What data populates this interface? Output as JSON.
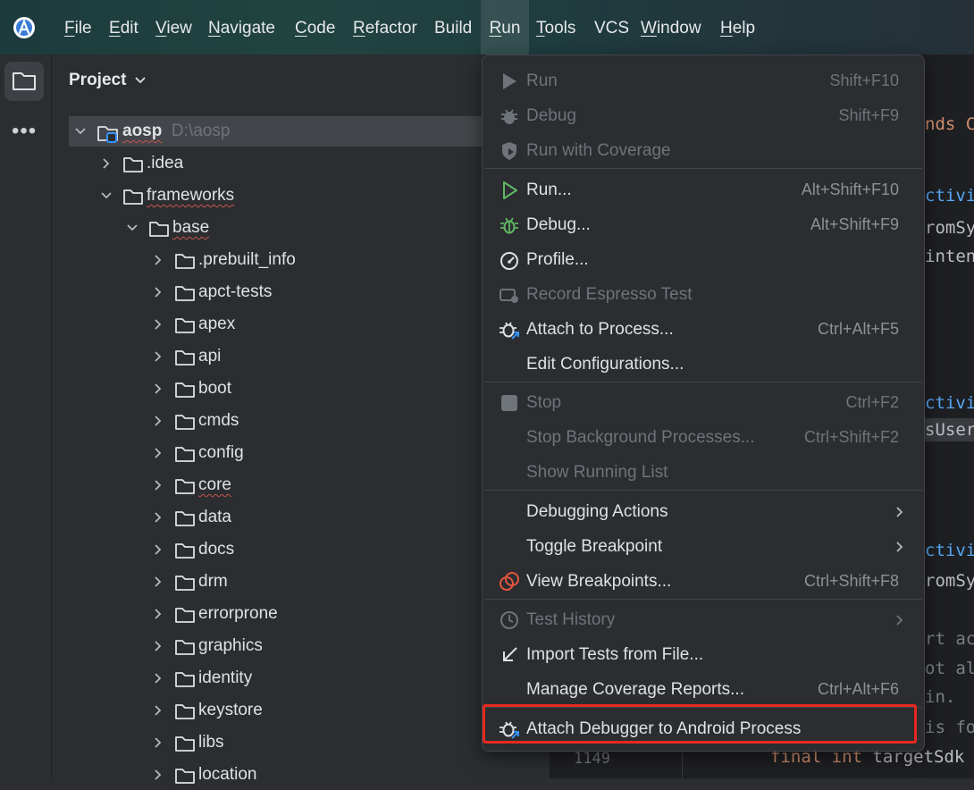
{
  "menubar": {
    "items": [
      {
        "first": "F",
        "rest": "ile"
      },
      {
        "first": "E",
        "rest": "dit"
      },
      {
        "first": "V",
        "rest": "iew"
      },
      {
        "first": "N",
        "rest": "avigate"
      },
      {
        "first": "C",
        "rest": "ode"
      },
      {
        "first": "R",
        "rest": "efactor"
      },
      {
        "first": "",
        "rest": "Build"
      },
      {
        "first": "R",
        "rest": "un"
      },
      {
        "first": "T",
        "rest": "ools"
      },
      {
        "first": "",
        "rest": "VCS"
      },
      {
        "first": "W",
        "rest": "indow"
      },
      {
        "first": "H",
        "rest": "elp"
      }
    ]
  },
  "project": {
    "header": "Project",
    "root_name": "aosp",
    "root_path": "D:\\aosp",
    "nodes": [
      ".idea",
      "frameworks",
      "base",
      ".prebuilt_info",
      "apct-tests",
      "apex",
      "api",
      "boot",
      "cmds",
      "config",
      "core",
      "data",
      "docs",
      "drm",
      "errorprone",
      "graphics",
      "identity",
      "keystore",
      "libs",
      "location"
    ]
  },
  "editor": {
    "lines": [
      {
        "kind": "kw",
        "text": "nds C"
      },
      {
        "kind": "fn",
        "text": "ctivi"
      },
      {
        "kind": "plain",
        "text": "romSy"
      },
      {
        "kind": "plain",
        "text": "inten"
      },
      {
        "kind": "fn",
        "text": "ctivi"
      },
      {
        "kind": "plain",
        "text": "sUser"
      },
      {
        "kind": "fn",
        "text": "ctivi"
      },
      {
        "kind": "plain",
        "text": "romSy"
      },
      {
        "kind": "comment",
        "text": "rt ac"
      },
      {
        "kind": "comment",
        "text": "ot al"
      },
      {
        "kind": "comment",
        "text": " in."
      },
      {
        "kind": "comment",
        "text": "is fo"
      }
    ],
    "gutter_number": "1149",
    "last_line_kw": "final int",
    "last_line_rest": " targetSdk"
  },
  "run_menu": {
    "items": [
      {
        "label": "Run",
        "shortcut": "Shift+F10",
        "icon": "run-triangle-icon"
      },
      {
        "label": "Debug",
        "shortcut": "Shift+F9",
        "icon": "debug-bug-icon"
      },
      {
        "label": "Run with Coverage",
        "shortcut": "",
        "icon": "coverage-shield-icon"
      },
      {
        "label": "Run...",
        "shortcut": "Alt+Shift+F10",
        "icon": "run-outline-icon"
      },
      {
        "label": "Debug...",
        "shortcut": "Alt+Shift+F9",
        "icon": "debug-outline-icon"
      },
      {
        "label": "Profile...",
        "shortcut": "",
        "icon": "profile-gauge-icon"
      },
      {
        "label": "Record Espresso Test",
        "shortcut": "",
        "icon": "record-espresso-icon"
      },
      {
        "label": "Attach to Process...",
        "shortcut": "Ctrl+Alt+F5",
        "icon": "attach-process-icon"
      },
      {
        "label": "Edit Configurations...",
        "shortcut": "",
        "icon": ""
      },
      {
        "label": "Stop",
        "shortcut": "Ctrl+F2",
        "icon": "stop-square-icon"
      },
      {
        "label": "Stop Background Processes...",
        "shortcut": "Ctrl+Shift+F2",
        "icon": ""
      },
      {
        "label": "Show Running List",
        "shortcut": "",
        "icon": ""
      },
      {
        "label": "Debugging Actions",
        "shortcut": "",
        "icon": ""
      },
      {
        "label": "Toggle Breakpoint",
        "shortcut": "",
        "icon": ""
      },
      {
        "label": "View Breakpoints...",
        "shortcut": "Ctrl+Shift+F8",
        "icon": "breakpoints-icon"
      },
      {
        "label": "Test History",
        "shortcut": "",
        "icon": "clock-icon"
      },
      {
        "label": "Import Tests from File...",
        "shortcut": "",
        "icon": "import-arrow-icon"
      },
      {
        "label": "Manage Coverage Reports...",
        "shortcut": "Ctrl+Alt+F6",
        "icon": ""
      },
      {
        "label": "Attach Debugger to Android Process",
        "shortcut": "",
        "icon": "attach-debugger-android-icon"
      }
    ]
  },
  "colors": {
    "accent_green": "#5fb865",
    "highlight_red": "#e5291f",
    "selection_bg": "#43454a"
  }
}
